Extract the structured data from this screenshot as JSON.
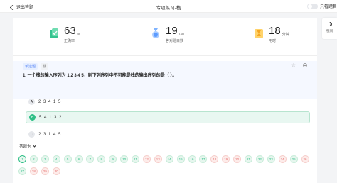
{
  "topbar": {
    "back_label": "退出答题",
    "title": "专项练习-栈",
    "recite_label": "只看题目"
  },
  "side": {
    "label": "夜间"
  },
  "stats": [
    {
      "value": "63",
      "unit": "%",
      "caption": "正确率"
    },
    {
      "value": "19",
      "unit": "/30",
      "caption": "答对题目数"
    },
    {
      "value": "18",
      "unit": "分钟",
      "caption": "用时"
    }
  ],
  "question": {
    "type_tag": "单选题",
    "chapter_tag": "栈",
    "text": "1. 一个栈的输入序列为 1 2 3 4 5，则下列序列中不可能是栈的输出序列的是（     ）。"
  },
  "options": [
    {
      "letter": "A",
      "text": "2 3 4 1 5"
    },
    {
      "letter": "B",
      "text": "5 4 1 3 2"
    },
    {
      "letter": "C",
      "text": "2 3 1 4 5"
    }
  ],
  "answer_card": {
    "title": "答题卡",
    "items": [
      {
        "n": "1",
        "s": "cur"
      },
      {
        "n": "2",
        "s": "green"
      },
      {
        "n": "3",
        "s": "green"
      },
      {
        "n": "4",
        "s": "green"
      },
      {
        "n": "5",
        "s": "green"
      },
      {
        "n": "6",
        "s": "green"
      },
      {
        "n": "7",
        "s": "green"
      },
      {
        "n": "8",
        "s": "green"
      },
      {
        "n": "9",
        "s": "green"
      },
      {
        "n": "10",
        "s": "green"
      },
      {
        "n": "11",
        "s": "green"
      },
      {
        "n": "12",
        "s": "red"
      },
      {
        "n": "13",
        "s": "red"
      },
      {
        "n": "14",
        "s": "green"
      },
      {
        "n": "15",
        "s": "green"
      },
      {
        "n": "16",
        "s": "green"
      },
      {
        "n": "17",
        "s": "green"
      },
      {
        "n": "18",
        "s": "red"
      },
      {
        "n": "19",
        "s": "red"
      },
      {
        "n": "20",
        "s": "red"
      },
      {
        "n": "21",
        "s": "green"
      },
      {
        "n": "22",
        "s": "green"
      },
      {
        "n": "23",
        "s": "green"
      },
      {
        "n": "24",
        "s": "red"
      },
      {
        "n": "25",
        "s": "green"
      },
      {
        "n": "26",
        "s": "red"
      },
      {
        "n": "27",
        "s": "green"
      },
      {
        "n": "28",
        "s": "red"
      },
      {
        "n": "29",
        "s": "red"
      },
      {
        "n": "30",
        "s": "red"
      }
    ]
  },
  "colors": {
    "accent_green": "#2fbf87",
    "accent_blue": "#4a7cf6",
    "wrong_red": "#e57373"
  }
}
